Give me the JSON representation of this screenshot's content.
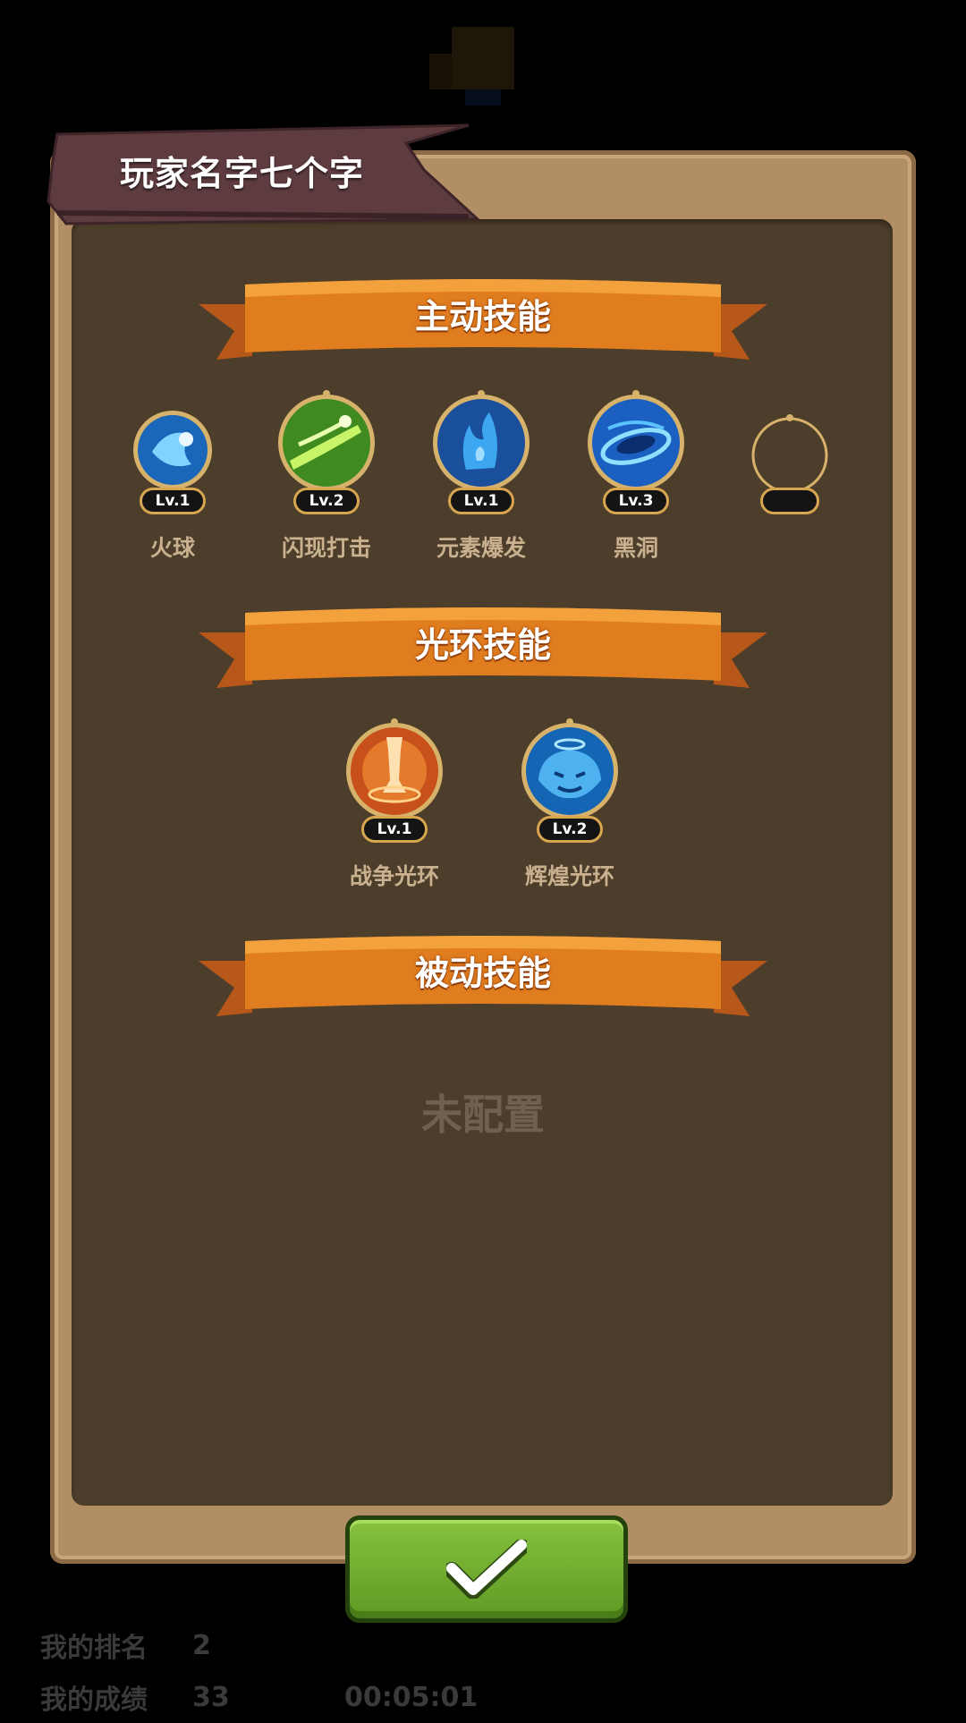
{
  "player": {
    "name": "玩家名字七个字"
  },
  "sections": {
    "active": {
      "title": "主动技能",
      "skills": [
        {
          "name": "火球",
          "level": "Lv.1",
          "icon": "fireball-icon"
        },
        {
          "name": "闪现打击",
          "level": "Lv.2",
          "icon": "flash-strike-icon"
        },
        {
          "name": "元素爆发",
          "level": "Lv.1",
          "icon": "elemental-burst-icon"
        },
        {
          "name": "黑洞",
          "level": "Lv.3",
          "icon": "black-hole-icon"
        },
        {
          "name": "",
          "level": "",
          "icon": "empty-slot"
        }
      ]
    },
    "aura": {
      "title": "光环技能",
      "skills": [
        {
          "name": "战争光环",
          "level": "Lv.1",
          "icon": "war-aura-icon"
        },
        {
          "name": "辉煌光环",
          "level": "Lv.2",
          "icon": "glory-aura-icon"
        }
      ]
    },
    "passive": {
      "title": "被动技能",
      "empty_text": "未配置"
    }
  },
  "background": {
    "rank_label": "我的排名",
    "rank_value": "2",
    "score_label": "我的成绩",
    "score_value": "33",
    "time_value": "00:05:01"
  },
  "colors": {
    "ribbon": "#e07d1f",
    "panel": "#b28e65",
    "inner": "#4d3e2b",
    "confirm": "#6fad2e"
  }
}
